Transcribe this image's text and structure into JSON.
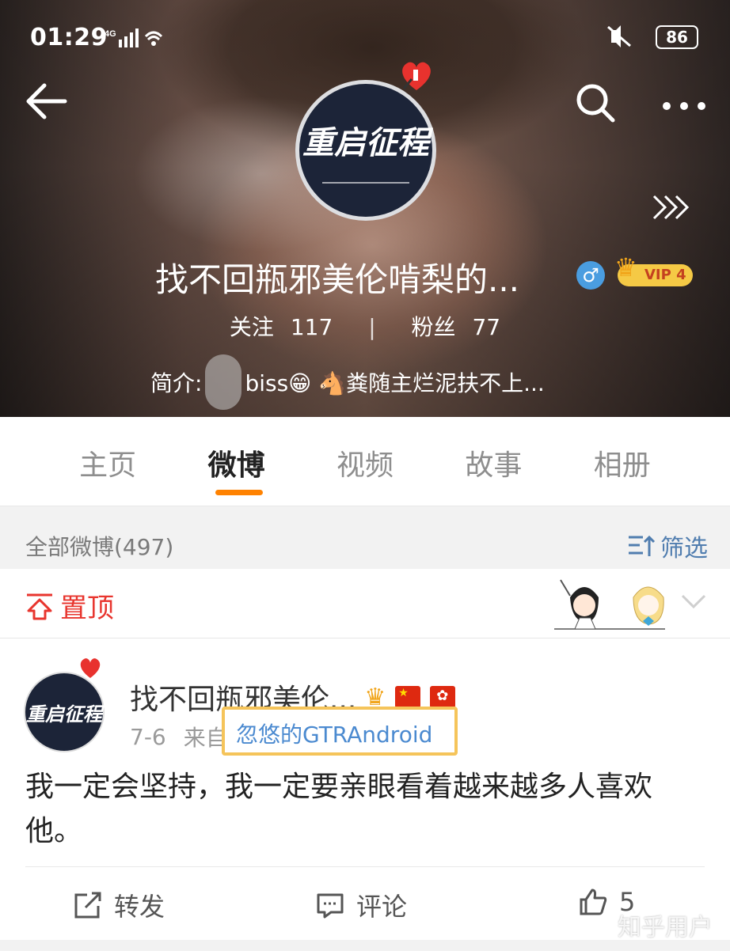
{
  "status_bar": {
    "time": "01:29",
    "signal": "4G",
    "battery": "86"
  },
  "profile": {
    "name": "找不回瓶邪美伦啃梨的...",
    "vip_label": "VIP 4",
    "follow_label": "关注",
    "follow_count": "117",
    "fans_label": "粉丝",
    "fans_count": "77",
    "bio_prefix": "简介:",
    "bio_text": "biss😁 🐴粪随主烂泥扶不上...",
    "avatar_text": "重启征程"
  },
  "tabs": [
    {
      "label": "主页",
      "active": false
    },
    {
      "label": "微博",
      "active": true
    },
    {
      "label": "视频",
      "active": false
    },
    {
      "label": "故事",
      "active": false
    },
    {
      "label": "相册",
      "active": false
    }
  ],
  "feed_header": {
    "all_label": "全部微博(497)",
    "filter_label": "筛选"
  },
  "pinned": {
    "label": "置顶"
  },
  "post": {
    "author": "找不回瓶邪美伦...",
    "date": "7-6",
    "source_prefix": "来自",
    "source": "忽悠的GTRAndroid",
    "text": "我一定会坚持，我一定要亲眼看着越来越多人喜欢他。",
    "repost_label": "转发",
    "comment_label": "评论",
    "like_count": "5"
  },
  "watermark": "知乎用户",
  "colors": {
    "accent_orange": "#ff8200",
    "pin_red": "#e8352e",
    "link_blue": "#4b8ad0",
    "highlight_box": "#f5c45a"
  }
}
